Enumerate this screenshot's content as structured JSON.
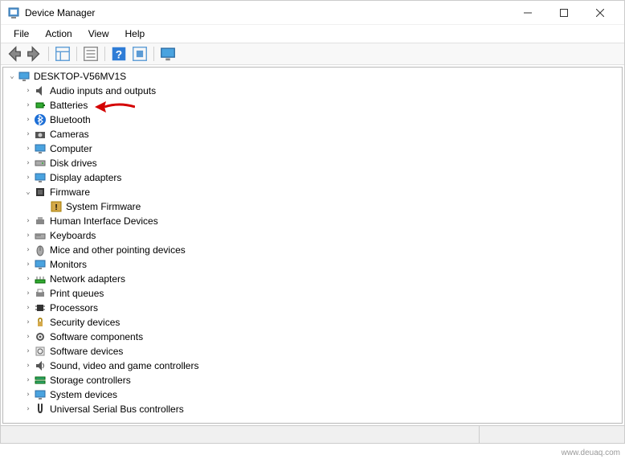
{
  "window": {
    "title": "Device Manager"
  },
  "menubar": {
    "file": "File",
    "action": "Action",
    "view": "View",
    "help": "Help"
  },
  "tree": {
    "root": "DESKTOP-V56MV1S",
    "items": [
      {
        "label": "Audio inputs and outputs",
        "expanded": false
      },
      {
        "label": "Batteries",
        "expanded": false
      },
      {
        "label": "Bluetooth",
        "expanded": false
      },
      {
        "label": "Cameras",
        "expanded": false
      },
      {
        "label": "Computer",
        "expanded": false
      },
      {
        "label": "Disk drives",
        "expanded": false
      },
      {
        "label": "Display adapters",
        "expanded": false
      },
      {
        "label": "Firmware",
        "expanded": true,
        "children": [
          {
            "label": "System Firmware",
            "warning": true
          }
        ]
      },
      {
        "label": "Human Interface Devices",
        "expanded": false
      },
      {
        "label": "Keyboards",
        "expanded": false
      },
      {
        "label": "Mice and other pointing devices",
        "expanded": false
      },
      {
        "label": "Monitors",
        "expanded": false
      },
      {
        "label": "Network adapters",
        "expanded": false
      },
      {
        "label": "Print queues",
        "expanded": false
      },
      {
        "label": "Processors",
        "expanded": false
      },
      {
        "label": "Security devices",
        "expanded": false
      },
      {
        "label": "Software components",
        "expanded": false
      },
      {
        "label": "Software devices",
        "expanded": false
      },
      {
        "label": "Sound, video and game controllers",
        "expanded": false
      },
      {
        "label": "Storage controllers",
        "expanded": false
      },
      {
        "label": "System devices",
        "expanded": false
      },
      {
        "label": "Universal Serial Bus controllers",
        "expanded": false
      }
    ]
  },
  "watermark": "www.deuaq.com",
  "annotation": {
    "highlighted_item": "Batteries",
    "arrow_color": "#d40000"
  }
}
